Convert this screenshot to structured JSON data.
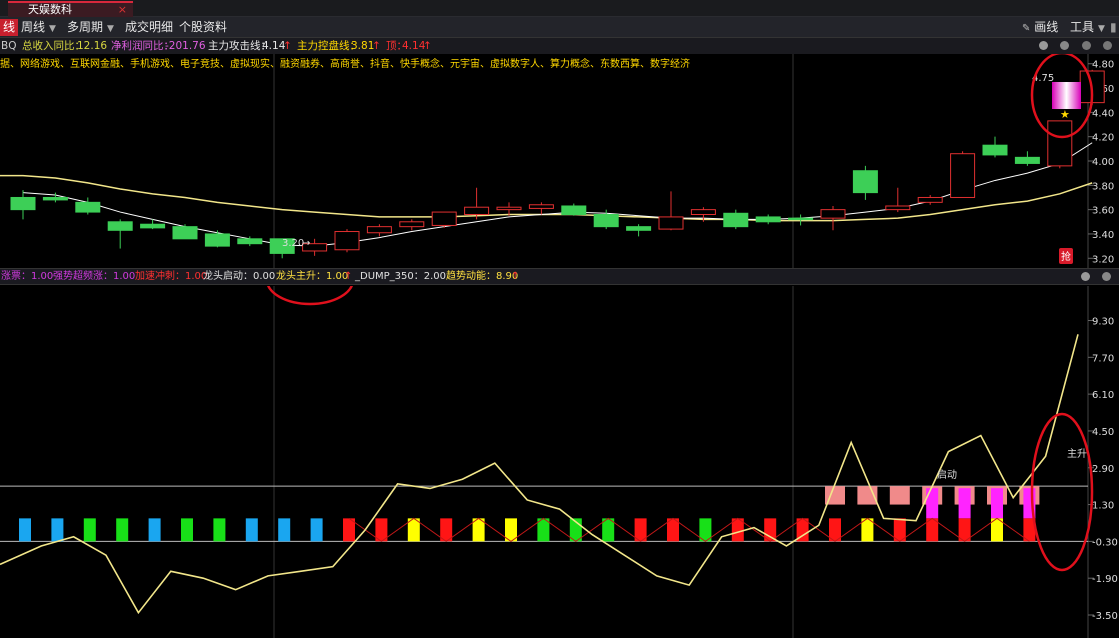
{
  "tab": {
    "title": "天娱数科",
    "close": "×"
  },
  "toolbar": {
    "period_active": "线",
    "weekly": "周线",
    "multi_period": "多周期",
    "trade_detail": "成交明细",
    "stock_info": "个股资料",
    "draw_line": "画线",
    "tools": "工具"
  },
  "infobar": {
    "prefix": "BQ",
    "revenue_yoy_label": "总收入同比：",
    "revenue_yoy": "12.16",
    "profit_yoy_label": "净利润同比：",
    "profit_yoy": "-201.76",
    "attack_line_label": "主力攻击线：",
    "attack_line": "4.14",
    "control_line_label": "主力控盘线：",
    "control_line": "3.81",
    "flag_label": "顶：",
    "flag_value": "4.14"
  },
  "concepts": "据、网络游戏、互联网金融、手机游戏、电子竞技、虚拟现实、融资融券、高商誉、抖音、快手概念、元宇宙、虚拟数字人、算力概念、东数西算、数字经济",
  "indicators": [
    {
      "text": "涨票：1.00",
      "color": "#d13ae0"
    },
    {
      "text": "强势超频涨：1.00",
      "color": "#d13ae0"
    },
    {
      "text": "加速冲刺：1.00",
      "color": "#ff3030"
    },
    {
      "text": "龙头启动：0.00",
      "color": "#e0e0e0"
    },
    {
      "text": "龙头主升：1.00",
      "color": "#ffe040"
    },
    {
      "text": "_DUMP_350：2.00",
      "color": "#e0e0e0"
    },
    {
      "text": "趋势动能：8.90",
      "color": "#ffe040"
    }
  ],
  "annotations": {
    "low_price": "3.20",
    "high_price": "4.75",
    "sub_start": "启动",
    "sub_main": "主升",
    "stamp": "抢"
  },
  "chart_data": [
    {
      "type": "candlestick",
      "y_ticks": [
        "4.80",
        "4.60",
        "4.40",
        "4.20",
        "4.00",
        "3.80",
        "3.60",
        "3.40",
        "3.20"
      ],
      "ylim": [
        3.12,
        4.88
      ],
      "candles": [
        {
          "o": 3.7,
          "h": 3.76,
          "l": 3.52,
          "c": 3.6
        },
        {
          "o": 3.7,
          "h": 3.74,
          "l": 3.66,
          "c": 3.68
        },
        {
          "o": 3.66,
          "h": 3.7,
          "l": 3.56,
          "c": 3.58
        },
        {
          "o": 3.5,
          "h": 3.52,
          "l": 3.28,
          "c": 3.43
        },
        {
          "o": 3.48,
          "h": 3.52,
          "l": 3.44,
          "c": 3.45
        },
        {
          "o": 3.46,
          "h": 3.48,
          "l": 3.36,
          "c": 3.36
        },
        {
          "o": 3.4,
          "h": 3.43,
          "l": 3.29,
          "c": 3.3
        },
        {
          "o": 3.36,
          "h": 3.38,
          "l": 3.3,
          "c": 3.32
        },
        {
          "o": 3.36,
          "h": 3.36,
          "l": 3.2,
          "c": 3.24
        },
        {
          "o": 3.26,
          "h": 3.36,
          "l": 3.22,
          "c": 3.32
        },
        {
          "o": 3.27,
          "h": 3.44,
          "l": 3.25,
          "c": 3.42
        },
        {
          "o": 3.41,
          "h": 3.48,
          "l": 3.38,
          "c": 3.46
        },
        {
          "o": 3.46,
          "h": 3.52,
          "l": 3.43,
          "c": 3.5
        },
        {
          "o": 3.47,
          "h": 3.56,
          "l": 3.45,
          "c": 3.58
        },
        {
          "o": 3.56,
          "h": 3.78,
          "l": 3.52,
          "c": 3.62
        },
        {
          "o": 3.6,
          "h": 3.66,
          "l": 3.55,
          "c": 3.62
        },
        {
          "o": 3.61,
          "h": 3.66,
          "l": 3.56,
          "c": 3.64
        },
        {
          "o": 3.63,
          "h": 3.65,
          "l": 3.55,
          "c": 3.56
        },
        {
          "o": 3.56,
          "h": 3.6,
          "l": 3.44,
          "c": 3.46
        },
        {
          "o": 3.46,
          "h": 3.48,
          "l": 3.38,
          "c": 3.43
        },
        {
          "o": 3.44,
          "h": 3.75,
          "l": 3.43,
          "c": 3.54
        },
        {
          "o": 3.56,
          "h": 3.62,
          "l": 3.5,
          "c": 3.6
        },
        {
          "o": 3.57,
          "h": 3.6,
          "l": 3.44,
          "c": 3.46
        },
        {
          "o": 3.54,
          "h": 3.56,
          "l": 3.48,
          "c": 3.5
        },
        {
          "o": 3.53,
          "h": 3.56,
          "l": 3.47,
          "c": 3.52
        },
        {
          "o": 3.53,
          "h": 3.63,
          "l": 3.43,
          "c": 3.6
        },
        {
          "o": 3.92,
          "h": 3.96,
          "l": 3.68,
          "c": 3.74
        },
        {
          "o": 3.6,
          "h": 3.78,
          "l": 3.58,
          "c": 3.63
        },
        {
          "o": 3.66,
          "h": 3.72,
          "l": 3.64,
          "c": 3.7
        },
        {
          "o": 3.7,
          "h": 4.08,
          "l": 3.7,
          "c": 4.06
        },
        {
          "o": 4.13,
          "h": 4.2,
          "l": 4.03,
          "c": 4.05
        },
        {
          "o": 4.03,
          "h": 4.08,
          "l": 3.96,
          "c": 3.98
        },
        {
          "o": 3.96,
          "h": 4.33,
          "l": 3.94,
          "c": 4.33
        },
        {
          "o": 4.48,
          "h": 4.75,
          "l": 4.46,
          "c": 4.74
        }
      ],
      "ma_slow": [
        3.88,
        3.86,
        3.82,
        3.77,
        3.73,
        3.7,
        3.66,
        3.63,
        3.6,
        3.58,
        3.56,
        3.54,
        3.54,
        3.54,
        3.55,
        3.56,
        3.56,
        3.56,
        3.55,
        3.54,
        3.53,
        3.52,
        3.52,
        3.51,
        3.51,
        3.51,
        3.52,
        3.53,
        3.56,
        3.6,
        3.64,
        3.67,
        3.73,
        3.82
      ],
      "ma_fast": [
        3.74,
        3.72,
        3.66,
        3.58,
        3.52,
        3.46,
        3.41,
        3.36,
        3.31,
        3.3,
        3.33,
        3.37,
        3.42,
        3.46,
        3.5,
        3.54,
        3.56,
        3.58,
        3.57,
        3.55,
        3.53,
        3.53,
        3.52,
        3.52,
        3.53,
        3.55,
        3.58,
        3.61,
        3.67,
        3.76,
        3.84,
        3.9,
        3.98,
        4.15
      ]
    },
    {
      "type": "line",
      "y_ticks": [
        "9.30",
        "7.70",
        "6.10",
        "4.50",
        "2.90",
        "1.30",
        "-0.30",
        "-1.90",
        "-3.50"
      ],
      "ylim": [
        -4.5,
        10.8
      ],
      "momentum": [
        -1.3,
        -0.5,
        -0.1,
        -0.9,
        -3.4,
        -1.6,
        -1.9,
        -2.4,
        -1.8,
        -1.6,
        -1.4,
        0.2,
        2.2,
        2.0,
        2.4,
        3.1,
        1.5,
        1.1,
        0.0,
        -0.9,
        -1.8,
        -2.2,
        -0.1,
        0.3,
        -0.5,
        0.4,
        4.0,
        0.7,
        0.6,
        3.6,
        4.3,
        1.6,
        3.4,
        8.7
      ],
      "bar_colors": [
        "#1aa6f0",
        "#1aa6f0",
        "#18e018",
        "#18e018",
        "#1aa6f0",
        "#18e018",
        "#18e018",
        "#1aa6f0",
        "#1aa6f0",
        "#1aa6f0",
        "#ff1515",
        "#ff1515",
        "#ffff00",
        "#ff1515",
        "#ffff00",
        "#ffff00",
        "#18e018",
        "#18e018",
        "#18e018",
        "#ff1515",
        "#ff1515",
        "#18e018",
        "#ff1515",
        "#ff1515",
        "#ff1515",
        "#ff1515",
        "#ffff00",
        "#ff1515",
        "#ff1515",
        "#ff1515",
        "#ffff00",
        "#ff1515"
      ],
      "upper_colors": {
        "25": "#f08a8a",
        "26": "#f08a8a",
        "27": "#f08a8a",
        "28": "#f08a8a",
        "29": "#f08a8a",
        "30": "#f08a8a",
        "31": "#f08a8a"
      },
      "magenta_from": 28
    }
  ]
}
